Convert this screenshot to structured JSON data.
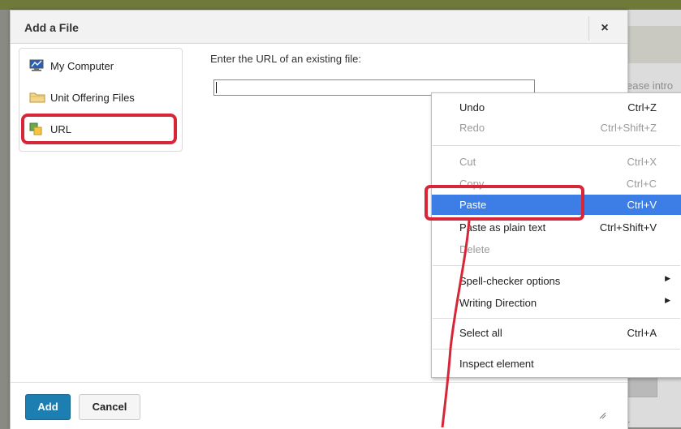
{
  "background": {
    "peek_text": "ease intro",
    "footer_peek": "r"
  },
  "dialog": {
    "title": "Add a File",
    "close_label": "×",
    "sources": [
      {
        "label": "My Computer",
        "icon": "monitor-icon"
      },
      {
        "label": "Unit Offering Files",
        "icon": "folder-icon"
      },
      {
        "label": "URL",
        "icon": "url-icon",
        "selected": true
      }
    ],
    "prompt": "Enter the URL of an existing file:",
    "url_value": "",
    "add_label": "Add",
    "cancel_label": "Cancel",
    "resize_icon": "resize-grip-icon"
  },
  "context_menu": {
    "items": [
      {
        "label": "Undo",
        "shortcut": "Ctrl+Z",
        "state": "enabled"
      },
      {
        "label": "Redo",
        "shortcut": "Ctrl+Shift+Z",
        "state": "disabled"
      },
      {
        "label": "Cut",
        "shortcut": "Ctrl+X",
        "state": "disabled"
      },
      {
        "label": "Copy",
        "shortcut": "Ctrl+C",
        "state": "disabled"
      },
      {
        "label": "Paste",
        "shortcut": "Ctrl+V",
        "state": "highlighted"
      },
      {
        "label": "Paste as plain text",
        "shortcut": "Ctrl+Shift+V",
        "state": "enabled"
      },
      {
        "label": "Delete",
        "shortcut": "",
        "state": "disabled"
      },
      {
        "label": "Spell-checker options",
        "shortcut": "",
        "state": "submenu"
      },
      {
        "label": "Writing Direction",
        "shortcut": "",
        "state": "submenu"
      },
      {
        "label": "Select all",
        "shortcut": "Ctrl+A",
        "state": "enabled"
      },
      {
        "label": "Inspect element",
        "shortcut": "",
        "state": "enabled"
      }
    ]
  },
  "colors": {
    "annotation_red": "#d72638",
    "menu_highlight": "#3d7ee6",
    "primary_button": "#1d7fb1"
  }
}
